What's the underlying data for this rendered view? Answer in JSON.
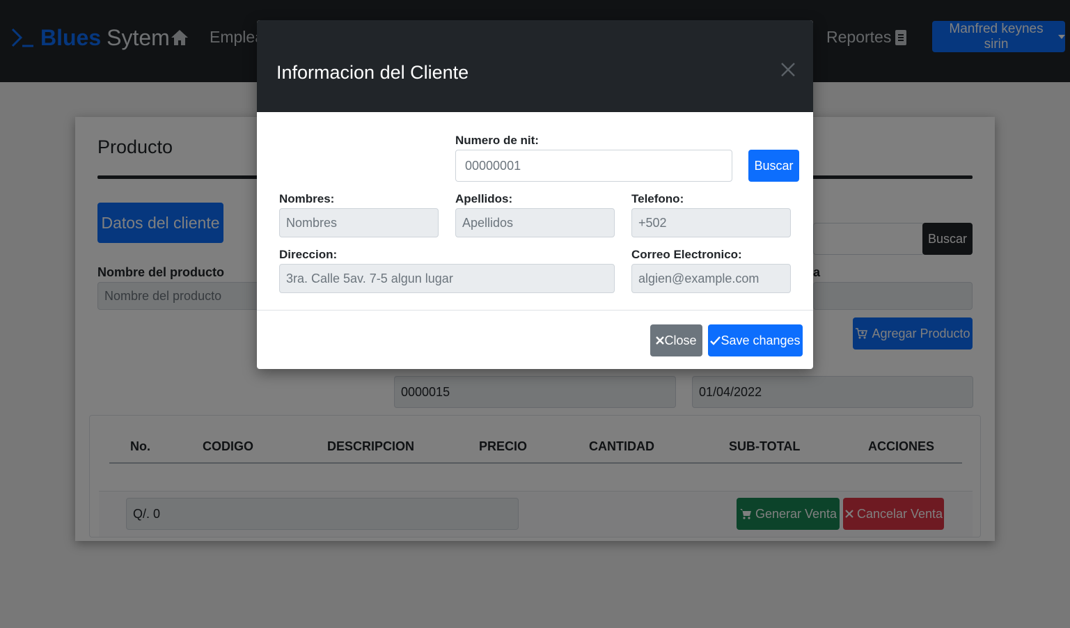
{
  "navbar": {
    "brand_blue": "Blues",
    "brand_rest": "Sytem",
    "empleados_label": "Empleados",
    "reportes_label": "Reportes",
    "user_label": "Manfred keynes sirin"
  },
  "page": {
    "card_title": "Producto",
    "datos_cliente_button": "Datos del cliente",
    "nombre_producto_label": "Nombre del producto",
    "nombre_producto_placeholder": "Nombre del producto",
    "partial_label": "a",
    "buscar_button": "Buscar",
    "agregar_button": "Agregar Producto",
    "numero_factura_value": "0000015",
    "fecha_value": "01/04/2022",
    "total_value": "Q/. 0",
    "table_headers": [
      "No.",
      "CODIGO",
      "DESCRIPCION",
      "PRECIO",
      "CANTIDAD",
      "SUB-TOTAL",
      "ACCIONES"
    ],
    "generar_button": "Generar Venta",
    "cancelar_button": "Cancelar Venta"
  },
  "modal": {
    "title": "Informacion del Cliente",
    "nit_label": "Numero de nit:",
    "nit_value": "00000001",
    "buscar_button": "Buscar",
    "nombres_label": "Nombres:",
    "nombres_placeholder": "Nombres",
    "apellidos_label": "Apellidos:",
    "apellidos_placeholder": "Apellidos",
    "telefono_label": "Telefono:",
    "telefono_placeholder": "+502",
    "direccion_label": "Direccion:",
    "direccion_placeholder": "3ra. Calle 5av. 7-5 algun lugar",
    "correo_label": "Correo Electronico:",
    "correo_placeholder": "algien@example.com",
    "close_button": "Close",
    "save_button": "Save changes"
  },
  "colors": {
    "primary": "#0d6efd",
    "dark": "#212529",
    "success": "#198754",
    "danger": "#dc3545",
    "secondary": "#6c757d"
  }
}
